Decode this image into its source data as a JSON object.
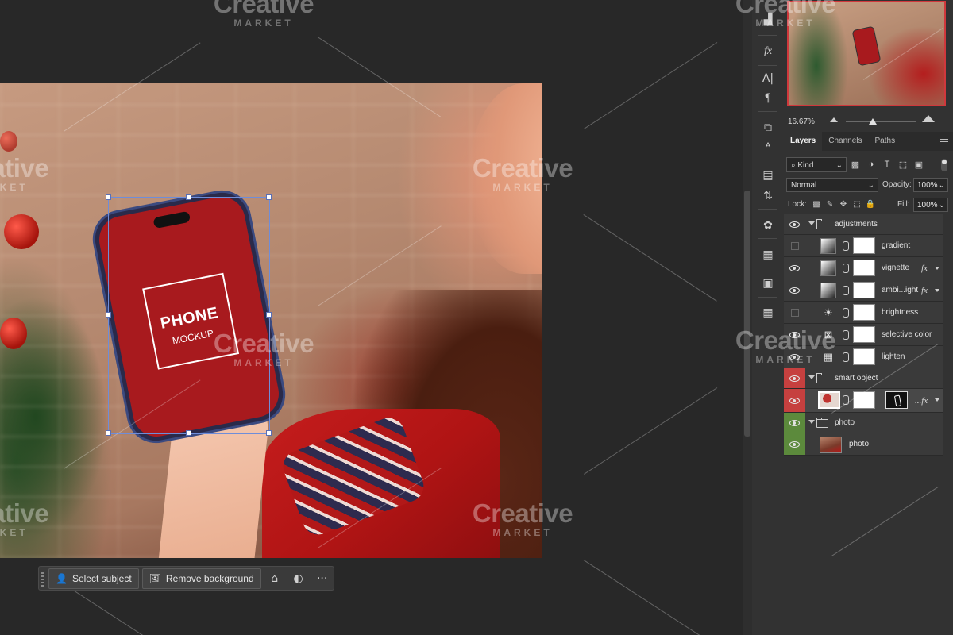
{
  "canvas": {
    "phone_title": "PHONE",
    "phone_subtitle": "MOCKUP"
  },
  "context_bar": {
    "select_subject": "Select subject",
    "remove_background": "Remove background",
    "more": "···"
  },
  "watermark": {
    "brand": "Creative",
    "sub": "MARKET"
  },
  "navigator": {
    "zoom": "16.67%"
  },
  "layers_panel": {
    "tabs": [
      "Layers",
      "Channels",
      "Paths"
    ],
    "filter_kind": "Kind",
    "blend_mode": "Normal",
    "opacity_label": "Opacity:",
    "opacity_value": "100%",
    "lock_label": "Lock:",
    "fill_label": "Fill:",
    "fill_value": "100%",
    "layers": [
      {
        "name": "adjustments",
        "type": "group",
        "visible": true
      },
      {
        "name": "gradient",
        "type": "adjustment",
        "visible": false
      },
      {
        "name": "vignette",
        "type": "adjustment",
        "visible": true,
        "fx": "fx"
      },
      {
        "name": "ambi...ight",
        "type": "adjustment",
        "visible": true,
        "fx": "fx"
      },
      {
        "name": "brightness",
        "type": "adjustment",
        "visible": false
      },
      {
        "name": "selective color",
        "type": "adjustment",
        "visible": true
      },
      {
        "name": "lighten",
        "type": "adjustment",
        "visible": true
      },
      {
        "name": "smart object",
        "type": "group",
        "visible": true,
        "color": "#c6403f"
      },
      {
        "name": "",
        "type": "smart-layer",
        "visible": true,
        "fx": "...fx",
        "color": "#c6403f"
      },
      {
        "name": "photo",
        "type": "group",
        "visible": true,
        "color": "#5c8a3c"
      },
      {
        "name": "photo",
        "type": "image",
        "visible": true,
        "color": "#5c8a3c"
      }
    ]
  }
}
